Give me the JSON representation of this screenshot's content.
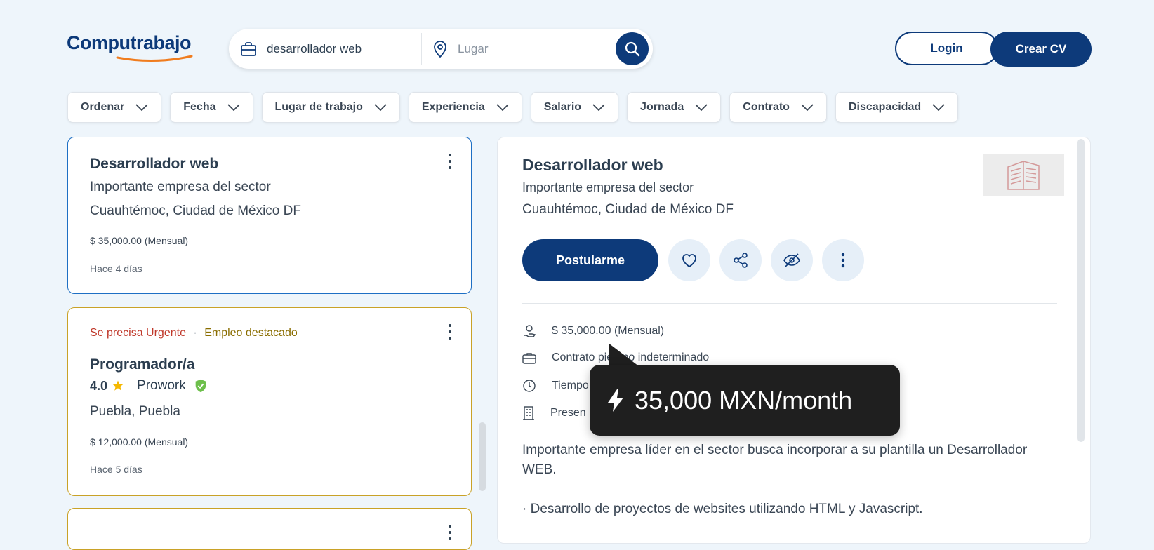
{
  "brand": {
    "name": "Computrabajo"
  },
  "search": {
    "query": "desarrollador web",
    "location_placeholder": "Lugar"
  },
  "header": {
    "login": "Login",
    "create_cv": "Crear CV"
  },
  "filters": [
    "Ordenar",
    "Fecha",
    "Lugar de trabajo",
    "Experiencia",
    "Salario",
    "Jornada",
    "Contrato",
    "Discapacidad"
  ],
  "jobs": [
    {
      "title": "Desarrollador web",
      "company": "Importante empresa del sector",
      "location": "Cuauhtémoc, Ciudad de México DF",
      "salary": "$ 35,000.00 (Mensual)",
      "posted": "Hace 4 días"
    },
    {
      "urgent": "Se precisa Urgente",
      "dot": "·",
      "featured": "Empleo destacado",
      "title": "Programador/a",
      "rating": "4.0",
      "company": "Prowork",
      "location": "Puebla, Puebla",
      "salary": "$ 12,000.00 (Mensual)",
      "posted": "Hace 5 días"
    }
  ],
  "detail": {
    "title": "Desarrollador web",
    "company": "Importante empresa del sector",
    "location": "Cuauhtémoc, Ciudad de México DF",
    "apply": "Postularme",
    "salary": "$ 35,000.00 (Mensual)",
    "contract": "Contrato por tiempo indeterminado",
    "contract_visible": "Contrato p",
    "contract_tail": "iempo indeterminado",
    "schedule": "Tiempo",
    "workplace": "Presen",
    "description_1": "Importante empresa líder en el sector busca incorporar a su plantilla un Desarrollador WEB.",
    "description_2": "· Desarrollo de proyectos de websites utilizando HTML y Javascript."
  },
  "tooltip": {
    "text": "35,000 MXN/month"
  },
  "colors": {
    "primary": "#0d3a7a",
    "urgent": "#c0392b",
    "featured": "#8a6d00",
    "selected_border": "#1e6fc4",
    "featured_border": "#c9a227"
  }
}
